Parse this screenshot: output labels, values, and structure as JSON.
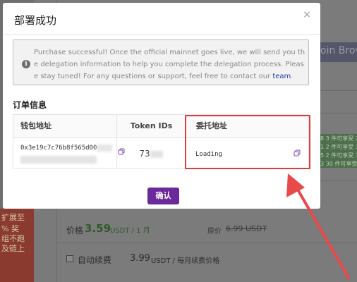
{
  "modal": {
    "title": "部署成功",
    "close_label": "×",
    "notice": {
      "icon": "info-icon",
      "text": "Purchase successful! Once the official mainnet goes live, we will send you the delegation information to help you complete the delegation process. Please stay tuned! For any questions or support, feel free to contact our ",
      "link_text": "team",
      "tail": "."
    },
    "section_title": "订单信息",
    "table": {
      "headers": {
        "wallet": "钱包地址",
        "token": "Token IDs",
        "delegation": "委托地址"
      },
      "row": {
        "wallet_prefix": "0x3e19c7c76b8f565d00",
        "token_prefix": "73",
        "delegation": "Loading"
      }
    },
    "confirm_label": "确认"
  },
  "background": {
    "banner_text": "oin Brov",
    "left_texts": [
      "扩展至",
      "% 奖",
      "组不跑",
      "及链上"
    ],
    "green_tags": [
      "8 3 件可享受 2",
      "1 2 件可享受 3",
      "5 2 件可享受 3",
      "3 30 件可享受"
    ],
    "price_label": "价格",
    "price_value": "3.59",
    "price_unit": "USDT / 1 月",
    "original_label": "原价",
    "original_value": "6.99 USDT",
    "renew_label": "自动续费",
    "renew_price": "3.99",
    "renew_unit": "USDT / 每月续费价格"
  },
  "colors": {
    "accent_purple": "#6a2a9c",
    "highlight_red": "#e23b3b",
    "link_blue": "#1a3ea8",
    "price_green": "#2f5a2a"
  }
}
